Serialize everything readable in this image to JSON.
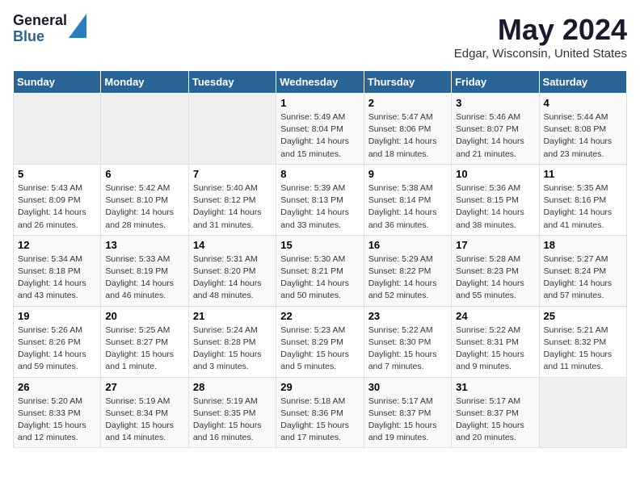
{
  "logo": {
    "general": "General",
    "blue": "Blue"
  },
  "title": "May 2024",
  "location": "Edgar, Wisconsin, United States",
  "days_of_week": [
    "Sunday",
    "Monday",
    "Tuesday",
    "Wednesday",
    "Thursday",
    "Friday",
    "Saturday"
  ],
  "weeks": [
    [
      {
        "day": "",
        "info": ""
      },
      {
        "day": "",
        "info": ""
      },
      {
        "day": "",
        "info": ""
      },
      {
        "day": "1",
        "info": "Sunrise: 5:49 AM\nSunset: 8:04 PM\nDaylight: 14 hours\nand 15 minutes."
      },
      {
        "day": "2",
        "info": "Sunrise: 5:47 AM\nSunset: 8:06 PM\nDaylight: 14 hours\nand 18 minutes."
      },
      {
        "day": "3",
        "info": "Sunrise: 5:46 AM\nSunset: 8:07 PM\nDaylight: 14 hours\nand 21 minutes."
      },
      {
        "day": "4",
        "info": "Sunrise: 5:44 AM\nSunset: 8:08 PM\nDaylight: 14 hours\nand 23 minutes."
      }
    ],
    [
      {
        "day": "5",
        "info": "Sunrise: 5:43 AM\nSunset: 8:09 PM\nDaylight: 14 hours\nand 26 minutes."
      },
      {
        "day": "6",
        "info": "Sunrise: 5:42 AM\nSunset: 8:10 PM\nDaylight: 14 hours\nand 28 minutes."
      },
      {
        "day": "7",
        "info": "Sunrise: 5:40 AM\nSunset: 8:12 PM\nDaylight: 14 hours\nand 31 minutes."
      },
      {
        "day": "8",
        "info": "Sunrise: 5:39 AM\nSunset: 8:13 PM\nDaylight: 14 hours\nand 33 minutes."
      },
      {
        "day": "9",
        "info": "Sunrise: 5:38 AM\nSunset: 8:14 PM\nDaylight: 14 hours\nand 36 minutes."
      },
      {
        "day": "10",
        "info": "Sunrise: 5:36 AM\nSunset: 8:15 PM\nDaylight: 14 hours\nand 38 minutes."
      },
      {
        "day": "11",
        "info": "Sunrise: 5:35 AM\nSunset: 8:16 PM\nDaylight: 14 hours\nand 41 minutes."
      }
    ],
    [
      {
        "day": "12",
        "info": "Sunrise: 5:34 AM\nSunset: 8:18 PM\nDaylight: 14 hours\nand 43 minutes."
      },
      {
        "day": "13",
        "info": "Sunrise: 5:33 AM\nSunset: 8:19 PM\nDaylight: 14 hours\nand 46 minutes."
      },
      {
        "day": "14",
        "info": "Sunrise: 5:31 AM\nSunset: 8:20 PM\nDaylight: 14 hours\nand 48 minutes."
      },
      {
        "day": "15",
        "info": "Sunrise: 5:30 AM\nSunset: 8:21 PM\nDaylight: 14 hours\nand 50 minutes."
      },
      {
        "day": "16",
        "info": "Sunrise: 5:29 AM\nSunset: 8:22 PM\nDaylight: 14 hours\nand 52 minutes."
      },
      {
        "day": "17",
        "info": "Sunrise: 5:28 AM\nSunset: 8:23 PM\nDaylight: 14 hours\nand 55 minutes."
      },
      {
        "day": "18",
        "info": "Sunrise: 5:27 AM\nSunset: 8:24 PM\nDaylight: 14 hours\nand 57 minutes."
      }
    ],
    [
      {
        "day": "19",
        "info": "Sunrise: 5:26 AM\nSunset: 8:26 PM\nDaylight: 14 hours\nand 59 minutes."
      },
      {
        "day": "20",
        "info": "Sunrise: 5:25 AM\nSunset: 8:27 PM\nDaylight: 15 hours\nand 1 minute."
      },
      {
        "day": "21",
        "info": "Sunrise: 5:24 AM\nSunset: 8:28 PM\nDaylight: 15 hours\nand 3 minutes."
      },
      {
        "day": "22",
        "info": "Sunrise: 5:23 AM\nSunset: 8:29 PM\nDaylight: 15 hours\nand 5 minutes."
      },
      {
        "day": "23",
        "info": "Sunrise: 5:22 AM\nSunset: 8:30 PM\nDaylight: 15 hours\nand 7 minutes."
      },
      {
        "day": "24",
        "info": "Sunrise: 5:22 AM\nSunset: 8:31 PM\nDaylight: 15 hours\nand 9 minutes."
      },
      {
        "day": "25",
        "info": "Sunrise: 5:21 AM\nSunset: 8:32 PM\nDaylight: 15 hours\nand 11 minutes."
      }
    ],
    [
      {
        "day": "26",
        "info": "Sunrise: 5:20 AM\nSunset: 8:33 PM\nDaylight: 15 hours\nand 12 minutes."
      },
      {
        "day": "27",
        "info": "Sunrise: 5:19 AM\nSunset: 8:34 PM\nDaylight: 15 hours\nand 14 minutes."
      },
      {
        "day": "28",
        "info": "Sunrise: 5:19 AM\nSunset: 8:35 PM\nDaylight: 15 hours\nand 16 minutes."
      },
      {
        "day": "29",
        "info": "Sunrise: 5:18 AM\nSunset: 8:36 PM\nDaylight: 15 hours\nand 17 minutes."
      },
      {
        "day": "30",
        "info": "Sunrise: 5:17 AM\nSunset: 8:37 PM\nDaylight: 15 hours\nand 19 minutes."
      },
      {
        "day": "31",
        "info": "Sunrise: 5:17 AM\nSunset: 8:37 PM\nDaylight: 15 hours\nand 20 minutes."
      },
      {
        "day": "",
        "info": ""
      }
    ]
  ]
}
